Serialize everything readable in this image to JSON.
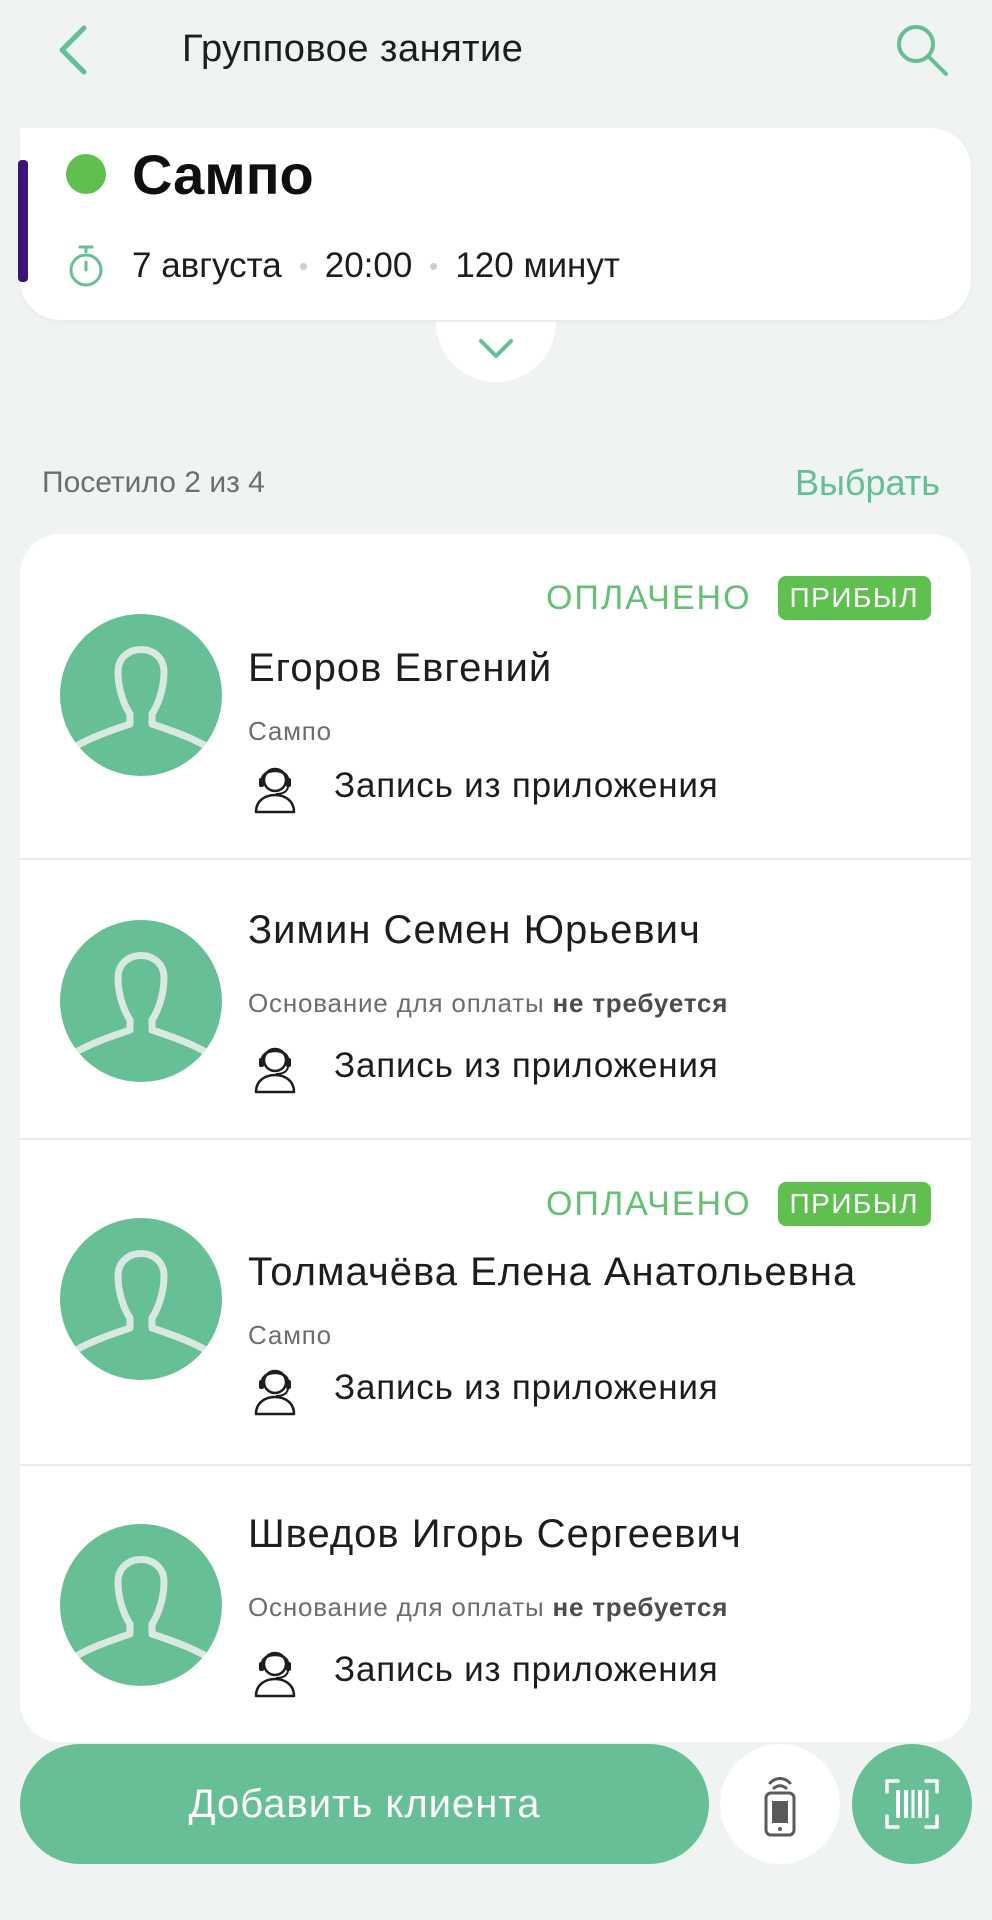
{
  "header": {
    "title": "Групповое занятие",
    "back_icon": "chevron-left-icon",
    "search_icon": "search-icon"
  },
  "class_info": {
    "name": "Сампо",
    "status_color": "#5fbf4f",
    "accent_color": "#3a1478",
    "date": "7 августа",
    "time": "20:00",
    "duration": "120 минут",
    "timer_icon": "stopwatch-icon",
    "expand_icon": "chevron-down-icon"
  },
  "attendance": {
    "summary": "Посетило 2 из 4",
    "select_label": "Выбрать"
  },
  "clients": [
    {
      "name": "Егоров Евгений",
      "subtitle": "Сампо",
      "source": "Запись из приложения",
      "paid_label": "ОПЛАЧЕНО",
      "arrived_label": "ПРИБЫЛ"
    },
    {
      "name": "Зимин Семен Юрьевич",
      "subtitle_prefix": "Основание для оплаты",
      "subtitle_bold": "не требуется",
      "source": "Запись из приложения"
    },
    {
      "name": "Толмачёва Елена Анатольевна",
      "subtitle": "Сампо",
      "source": "Запись из приложения",
      "paid_label": "ОПЛАЧЕНО",
      "arrived_label": "ПРИБЫЛ"
    },
    {
      "name": "Шведов Игорь Сергеевич",
      "subtitle_prefix": "Основание для оплаты",
      "subtitle_bold": "не требуется",
      "source": "Запись из приложения"
    }
  ],
  "actions": {
    "add_client_label": "Добавить клиента",
    "nfc_icon": "nfc-phone-icon",
    "scan_icon": "barcode-scan-icon"
  },
  "colors": {
    "primary": "#67bf96",
    "paid": "#64c072",
    "arrived": "#5fbf4f",
    "background": "#eff3f1"
  }
}
